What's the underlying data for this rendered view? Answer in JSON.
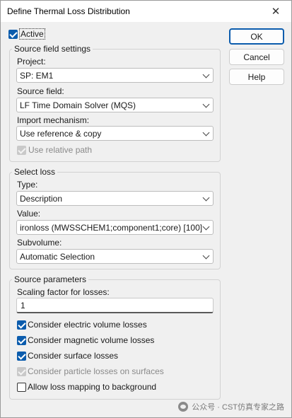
{
  "window": {
    "title": "Define Thermal Loss Distribution",
    "close_glyph": "✕"
  },
  "active": {
    "label": "Active",
    "checked": true
  },
  "buttons": {
    "ok": "OK",
    "cancel": "Cancel",
    "help": "Help"
  },
  "source_field": {
    "legend": "Source field settings",
    "project_label": "Project:",
    "project_value": "SP: EM1",
    "source_label": "Source field:",
    "source_value": "LF Time Domain Solver (MQS)",
    "import_label": "Import mechanism:",
    "import_value": "Use reference & copy",
    "relative_path_label": "Use relative path",
    "relative_path_checked": true,
    "relative_path_enabled": false
  },
  "select_loss": {
    "legend": "Select loss",
    "type_label": "Type:",
    "type_value": "Description",
    "value_label": "Value:",
    "value_value": "ironloss (MWSSCHEM1;component1;core) [100]",
    "subvolume_label": "Subvolume:",
    "subvolume_value": "Automatic Selection"
  },
  "source_params": {
    "legend": "Source parameters",
    "scaling_label": "Scaling factor for losses:",
    "scaling_value": "1",
    "checkboxes": [
      {
        "label": "Consider electric volume losses",
        "checked": true,
        "enabled": true
      },
      {
        "label": "Consider magnetic volume losses",
        "checked": true,
        "enabled": true
      },
      {
        "label": "Consider surface losses",
        "checked": true,
        "enabled": true
      },
      {
        "label": "Consider particle losses on surfaces",
        "checked": true,
        "enabled": false
      },
      {
        "label": "Allow loss mapping to background",
        "checked": false,
        "enabled": true
      }
    ]
  },
  "watermark": {
    "text": "公众号 · CST仿真专家之路",
    "icon": "wechat-icon"
  }
}
